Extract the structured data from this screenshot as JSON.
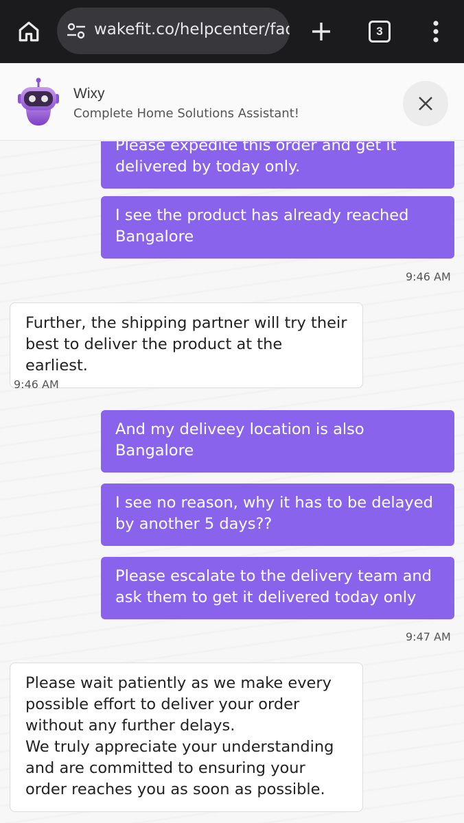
{
  "browser": {
    "url": "wakefit.co/helpcenter/faq/",
    "tab_count": "3"
  },
  "header": {
    "bot_name": "Wixy",
    "bot_subtitle": "Complete Home Solutions Assistant!"
  },
  "messages": [
    {
      "sender": "user",
      "text": "Please expedite this order and get it delivered by today only."
    },
    {
      "sender": "user",
      "text": "I see the product has already reached Bangalore"
    },
    {
      "sender": "time",
      "text": "9:46 AM"
    },
    {
      "sender": "bot",
      "text": "Further, the shipping partner will try their best to deliver the product at the earliest."
    },
    {
      "sender": "time",
      "text": "9:46 AM"
    },
    {
      "sender": "user",
      "text": "And my deliveey location is also Bangalore"
    },
    {
      "sender": "user",
      "text": "I see no reason, why it has to be delayed by another 5 days??"
    },
    {
      "sender": "user",
      "text": "Please escalate to the delivery team and ask them to get it delivered today only"
    },
    {
      "sender": "time",
      "text": "9:47 AM"
    },
    {
      "sender": "bot",
      "text": "Please wait patiently as we make every possible effort to deliver your order without any further delays.\nWe truly appreciate your understanding and are committed to ensuring your order reaches you as soon as possible."
    }
  ],
  "colors": {
    "user_bubble": "#8a63ec",
    "browser_bar": "#1b1b1d"
  }
}
